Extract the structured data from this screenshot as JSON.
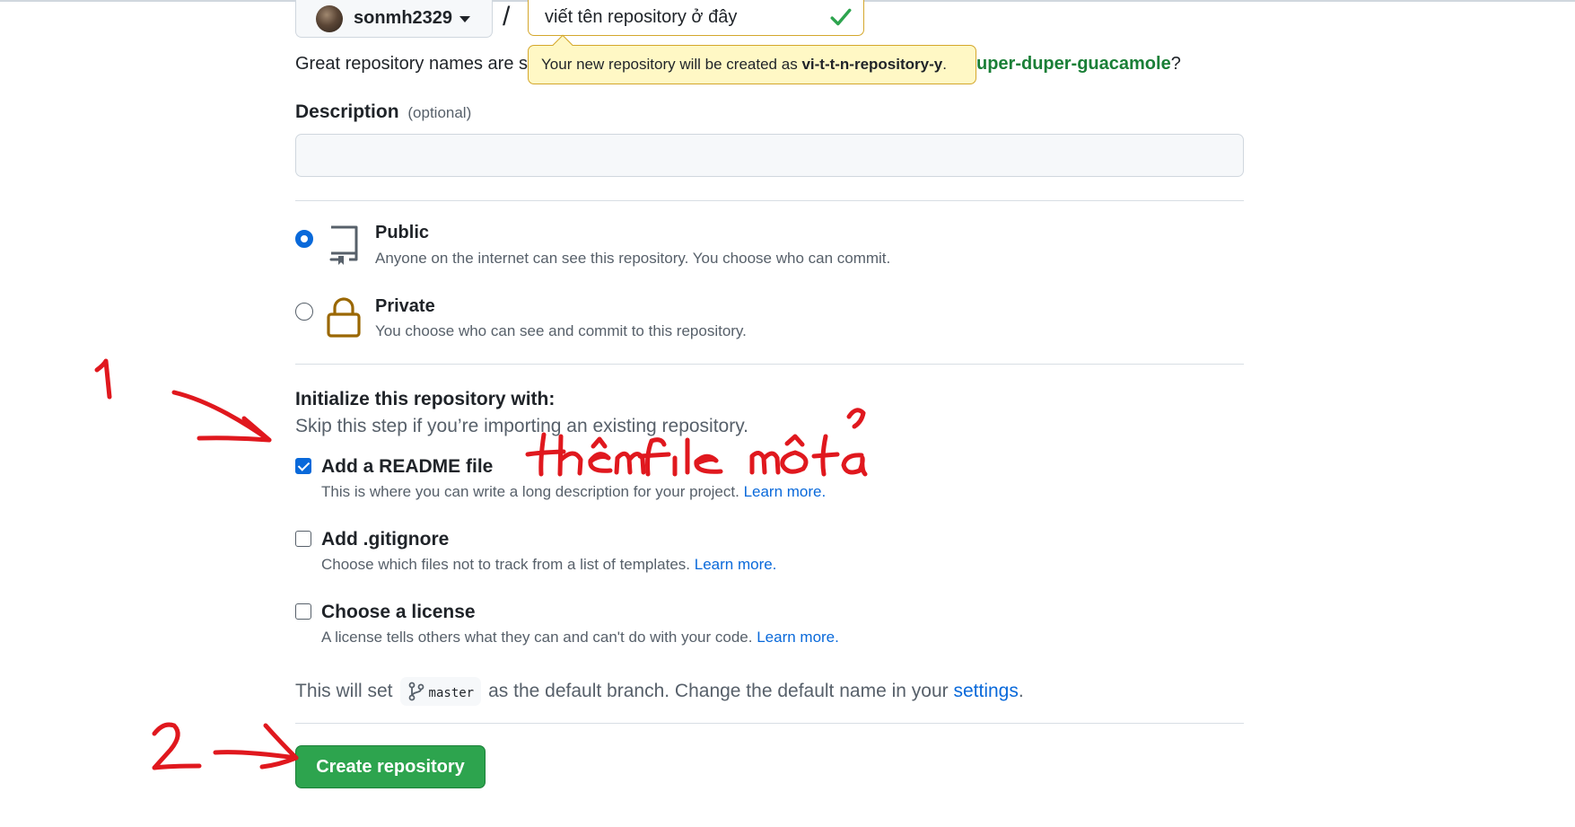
{
  "owner": {
    "name": "sonmh2329"
  },
  "separator": "/",
  "repo_name": {
    "value": "viết tên repository ở đây"
  },
  "name_hint": {
    "prefix": "Great repository names are s",
    "suggestion": "uper-duper-guacamole",
    "suffix": "?"
  },
  "tooltip": {
    "text": "Your new repository will be created as",
    "repo_slug": "vi-t-t-n-repository-y",
    "suffix": "."
  },
  "description": {
    "label": "Description",
    "optional": "(optional)",
    "value": ""
  },
  "visibility": {
    "public": {
      "title": "Public",
      "desc": "Anyone on the internet can see this repository. You choose who can commit.",
      "selected": true
    },
    "private": {
      "title": "Private",
      "desc": "You choose who can see and commit to this repository.",
      "selected": false
    }
  },
  "initialize": {
    "title": "Initialize this repository with:",
    "subtitle": "Skip this step if you’re importing an existing repository.",
    "readme": {
      "title": "Add a README file",
      "desc": "This is where you can write a long description for your project.",
      "link": "Learn more.",
      "checked": true
    },
    "gitignore": {
      "title": "Add .gitignore",
      "desc": "Choose which files not to track from a list of templates.",
      "link": "Learn more.",
      "checked": false
    },
    "license": {
      "title": "Choose a license",
      "desc": "A license tells others what they can and can't do with your code.",
      "link": "Learn more.",
      "checked": false
    }
  },
  "branch": {
    "before": "This will set",
    "name": "master",
    "after": "as the default branch. Change the default name in your",
    "link": "settings",
    "end": "."
  },
  "create_button": "Create repository",
  "annotations": {
    "marker_1": "1",
    "note_1": "thêm file mô tả",
    "marker_2": "2",
    "color": "#e0181e"
  },
  "colors": {
    "primary_button": "#2da44e",
    "link": "#0969da",
    "success": "#1a7f37",
    "tooltip_bg": "#fff8c5"
  },
  "icons": [
    "chevron-down-icon",
    "check-icon",
    "repo-icon",
    "lock-icon",
    "git-branch-icon"
  ]
}
